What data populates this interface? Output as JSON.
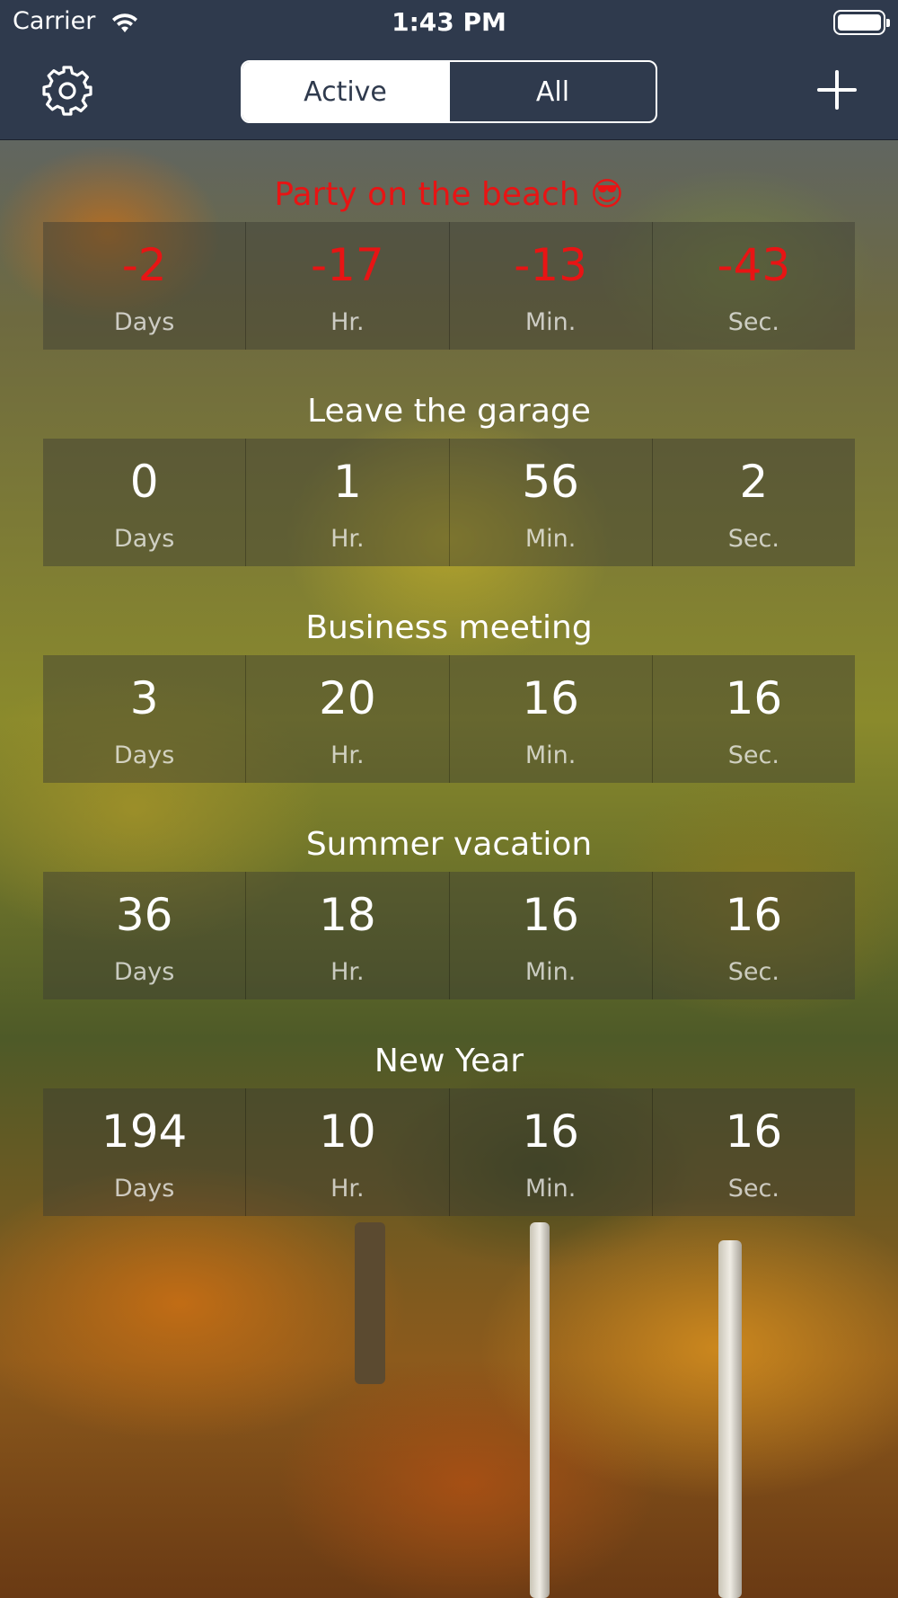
{
  "status_bar": {
    "carrier": "Carrier",
    "time": "1:43 PM"
  },
  "nav": {
    "segments": [
      "Active",
      "All"
    ],
    "selected_segment": "Active"
  },
  "colors": {
    "bar_background": "#2f3a4d",
    "overdue_text": "#e81414"
  },
  "icons": {
    "settings": "gear-icon",
    "add": "plus-icon"
  },
  "units": {
    "days": "Days",
    "hours": "Hr.",
    "minutes": "Min.",
    "seconds": "Sec."
  },
  "events": [
    {
      "title": "Party on the beach 😎",
      "days": "-2",
      "hours": "-17",
      "minutes": "-13",
      "seconds": "-43",
      "overdue": true
    },
    {
      "title": "Leave the garage",
      "days": "0",
      "hours": "1",
      "minutes": "56",
      "seconds": "2",
      "overdue": false
    },
    {
      "title": "Business meeting",
      "days": "3",
      "hours": "20",
      "minutes": "16",
      "seconds": "16",
      "overdue": false
    },
    {
      "title": "Summer vacation",
      "days": "36",
      "hours": "18",
      "minutes": "16",
      "seconds": "16",
      "overdue": false
    },
    {
      "title": "New Year",
      "days": "194",
      "hours": "10",
      "minutes": "16",
      "seconds": "16",
      "overdue": false
    }
  ]
}
